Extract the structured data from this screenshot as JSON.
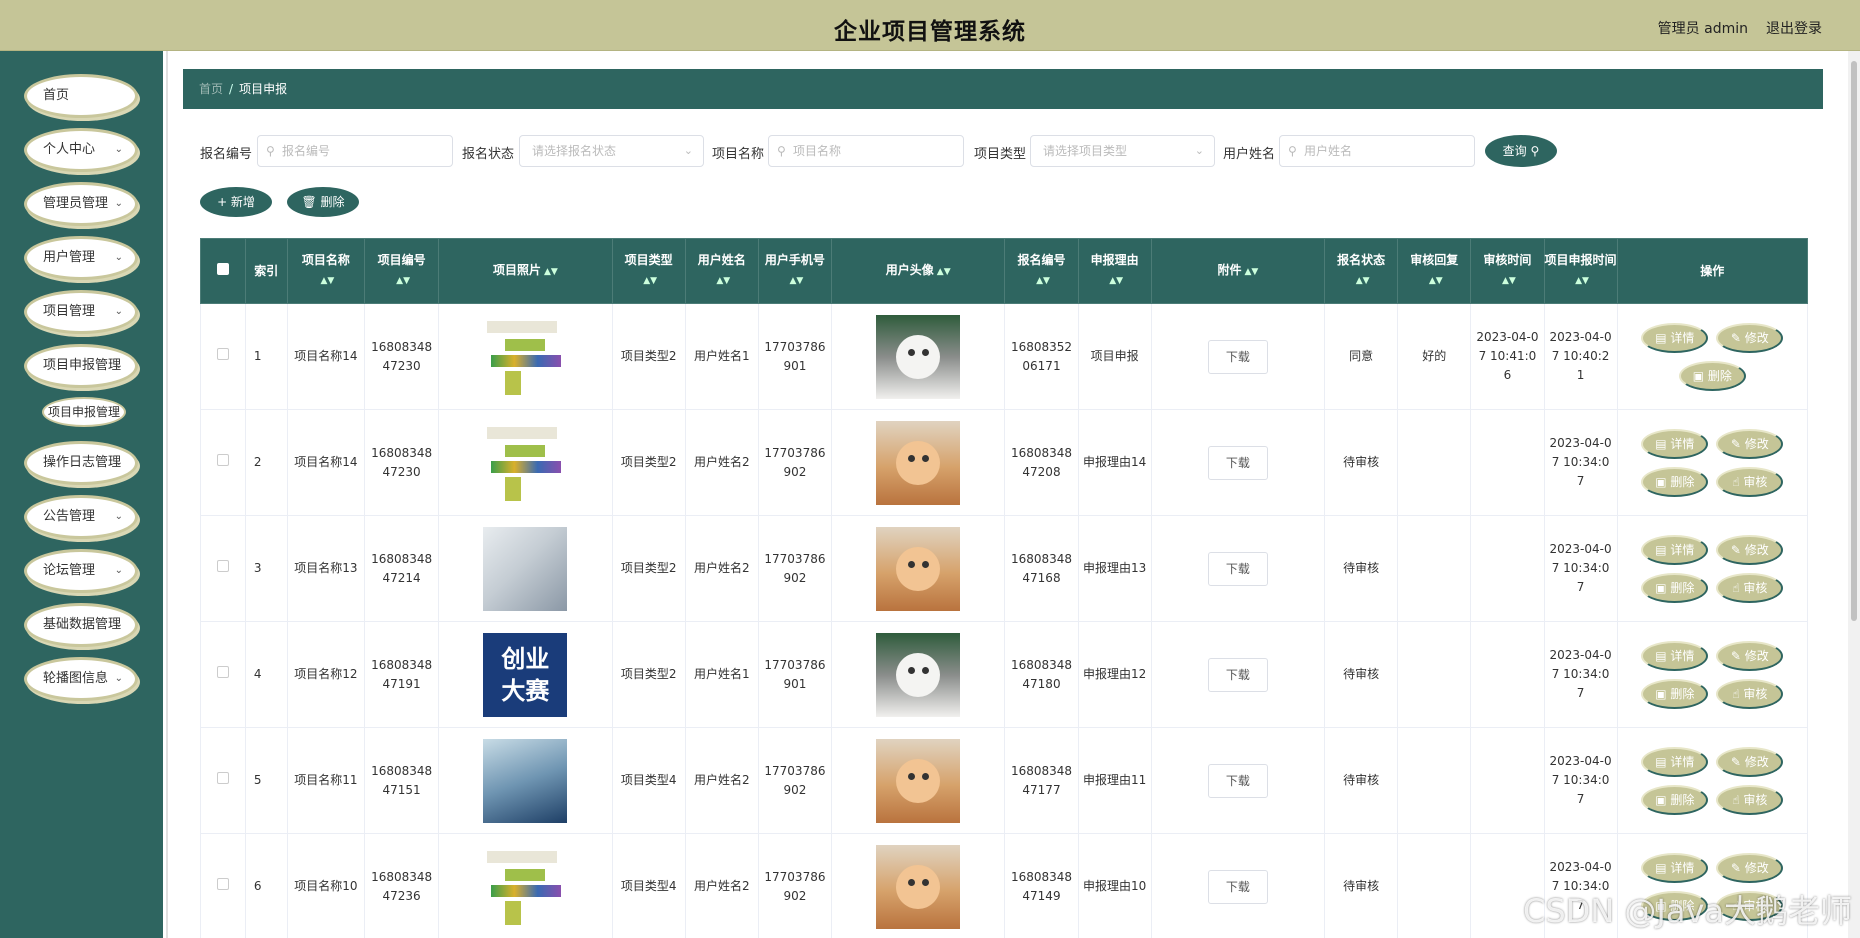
{
  "header": {
    "title": "企业项目管理系统",
    "user": "管理员 admin",
    "logout": "退出登录"
  },
  "sidebar": {
    "items": [
      {
        "label": "首页",
        "chevron": false
      },
      {
        "label": "个人中心",
        "chevron": true
      },
      {
        "label": "管理员管理",
        "chevron": true
      },
      {
        "label": "用户管理",
        "chevron": true
      },
      {
        "label": "项目管理",
        "chevron": true
      },
      {
        "label": "项目申报管理",
        "chevron": true
      },
      {
        "label": "操作日志管理",
        "chevron": true
      },
      {
        "label": "公告管理",
        "chevron": true
      },
      {
        "label": "论坛管理",
        "chevron": true
      },
      {
        "label": "基础数据管理",
        "chevron": true
      },
      {
        "label": "轮播图信息",
        "chevron": true
      }
    ],
    "sub_item": "项目申报管理"
  },
  "breadcrumb": {
    "home": "首页",
    "separator": "/",
    "current": "项目申报"
  },
  "search": {
    "f1_label": "报名编号",
    "f1_placeholder": "报名编号",
    "f2_label": "报名状态",
    "f2_placeholder": "请选择报名状态",
    "f3_label": "项目名称",
    "f3_placeholder": "项目名称",
    "f4_label": "项目类型",
    "f4_placeholder": "请选择项目类型",
    "f5_label": "用户姓名",
    "f5_placeholder": "用户姓名",
    "query": "查询"
  },
  "actions": {
    "add": "+ 新增",
    "delete": "删除"
  },
  "table": {
    "columns": [
      "索引",
      "项目名称",
      "项目编号",
      "项目照片",
      "项目类型",
      "用户姓名",
      "用户手机号",
      "用户头像",
      "报名编号",
      "申报理由",
      "附件",
      "报名状态",
      "审核回复",
      "审核时间",
      "项目申报时间",
      "操作"
    ],
    "download": "下载",
    "op_labels": {
      "detail": "详情",
      "edit": "修改",
      "delete": "删除",
      "review": "审核"
    },
    "rows": [
      {
        "index": "1",
        "name": "项目名称14",
        "code": "1680834847230",
        "type": "项目类型2",
        "user": "用户姓名1",
        "phone": "17703786901",
        "sign_no": "1680835206171",
        "reason": "项目申报",
        "status": "同意",
        "reply": "好的",
        "review_time": "2023-04-07 10:41:06",
        "apply_time": "2023-04-07 10:40:21",
        "photo": "chart",
        "avatar": "cat-grey"
      },
      {
        "index": "2",
        "name": "项目名称14",
        "code": "1680834847230",
        "type": "项目类型2",
        "user": "用户姓名2",
        "phone": "17703786902",
        "sign_no": "1680834847208",
        "reason": "申报理由14",
        "status": "待审核",
        "reply": "",
        "review_time": "",
        "apply_time": "2023-04-07 10:34:07",
        "photo": "chart",
        "avatar": "cat-orange"
      },
      {
        "index": "3",
        "name": "项目名称13",
        "code": "1680834847214",
        "type": "项目类型2",
        "user": "用户姓名2",
        "phone": "17703786902",
        "sign_no": "1680834847168",
        "reason": "申报理由13",
        "status": "待审核",
        "reply": "",
        "review_time": "",
        "apply_time": "2023-04-07 10:34:07",
        "photo": "office",
        "avatar": "cat-orange"
      },
      {
        "index": "4",
        "name": "项目名称12",
        "code": "1680834847191",
        "type": "项目类型2",
        "user": "用户姓名1",
        "phone": "17703786901",
        "sign_no": "1680834847180",
        "reason": "申报理由12",
        "status": "待审核",
        "reply": "",
        "review_time": "",
        "apply_time": "2023-04-07 10:34:07",
        "photo": "contest",
        "avatar": "cat-grey"
      },
      {
        "index": "5",
        "name": "项目名称11",
        "code": "1680834847151",
        "type": "项目类型4",
        "user": "用户姓名2",
        "phone": "17703786902",
        "sign_no": "1680834847177",
        "reason": "申报理由11",
        "status": "待审核",
        "reply": "",
        "review_time": "",
        "apply_time": "2023-04-07 10:34:07",
        "photo": "tech",
        "avatar": "cat-orange"
      },
      {
        "index": "6",
        "name": "项目名称10",
        "code": "1680834847236",
        "type": "项目类型4",
        "user": "用户姓名2",
        "phone": "17703786902",
        "sign_no": "1680834847149",
        "reason": "申报理由10",
        "status": "待审核",
        "reply": "",
        "review_time": "",
        "apply_time": "2023-04-07 10:34:07",
        "photo": "chart",
        "avatar": "cat-orange"
      }
    ]
  },
  "contest_text": [
    "创业",
    "大赛"
  ],
  "watermark": "CSDN @Java大鹅老师",
  "colors": {
    "primary": "#2e6560",
    "accent": "#c5c597"
  }
}
